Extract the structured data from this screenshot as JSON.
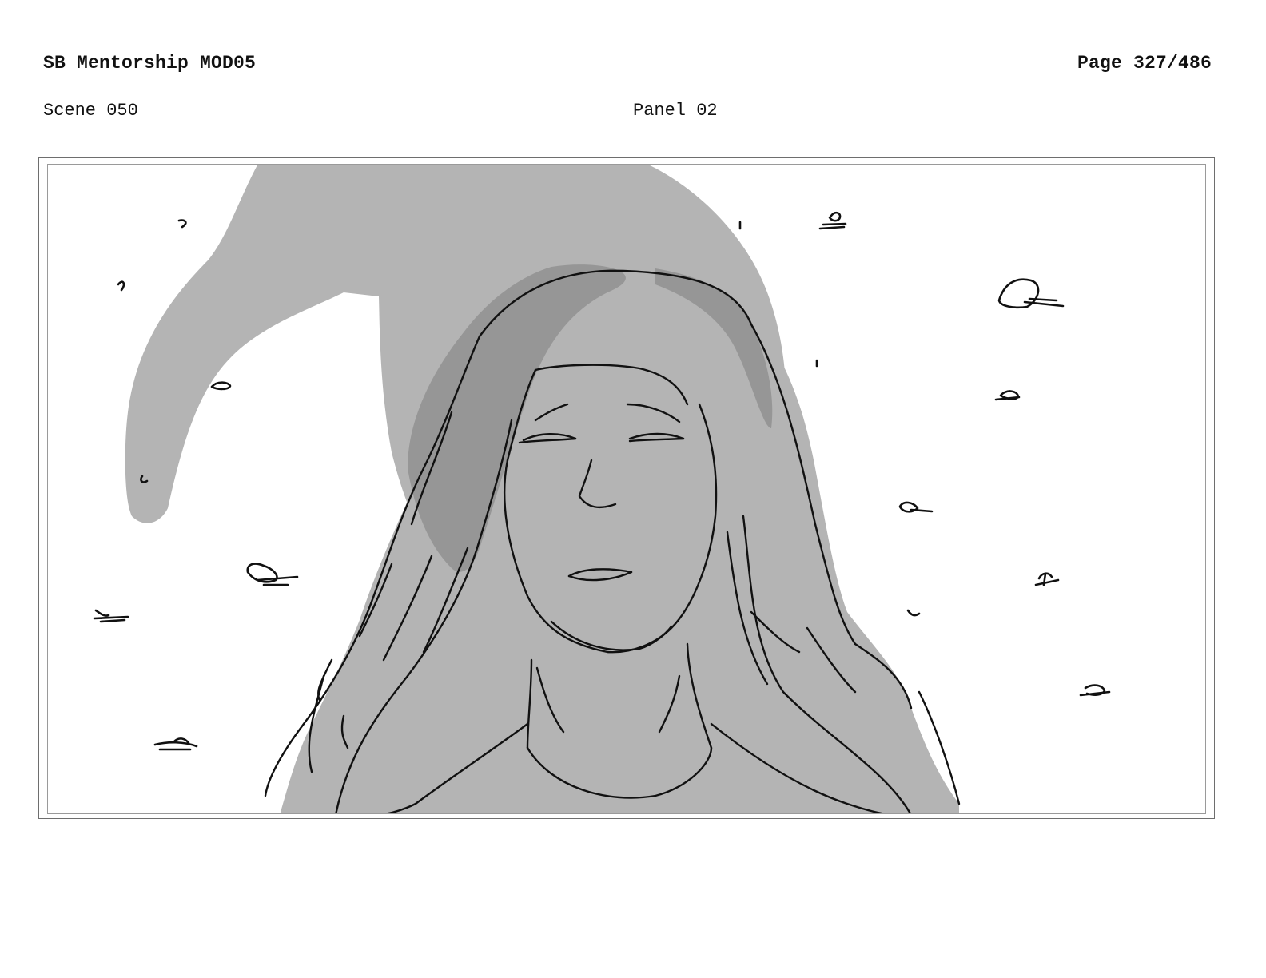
{
  "header": {
    "title": "SB Mentorship MOD05",
    "page": "Page 327/486"
  },
  "panel_info": {
    "scene": "Scene 050",
    "panel": "Panel 02"
  },
  "colors": {
    "sketch_fill": "#b4b4b4",
    "hair_shadow": "#969696",
    "line": "#111111",
    "frame": "#7a7a7a"
  }
}
